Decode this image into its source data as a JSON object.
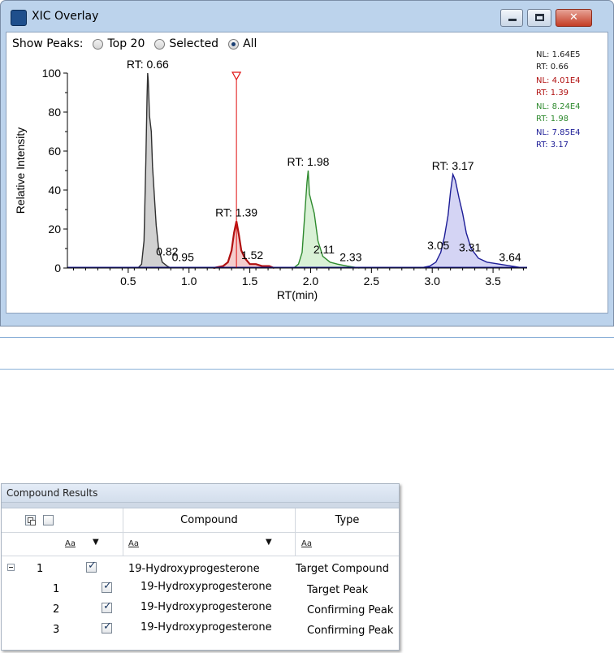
{
  "window": {
    "title": "XIC Overlay"
  },
  "show_peaks": {
    "label": "Show Peaks:",
    "options": [
      "Top 20",
      "Selected",
      "All"
    ],
    "selected": "All"
  },
  "chart_data": {
    "type": "line",
    "xlabel": "RT(min)",
    "ylabel": "Relative Intensity",
    "xlim": [
      0,
      3.78
    ],
    "ylim": [
      0,
      100
    ],
    "xticks": [
      0.5,
      1.0,
      1.5,
      2.0,
      2.5,
      3.0,
      3.5
    ],
    "xtick_labels": [
      "0.5",
      "1.0",
      "1.5",
      "2.0",
      "2.5",
      "3.0",
      "3.5"
    ],
    "yticks": [
      0,
      20,
      40,
      60,
      80,
      100
    ],
    "ytick_labels": [
      "0",
      "20",
      "40",
      "60",
      "80",
      "100"
    ],
    "colors": {
      "grey": "#303030",
      "red": "#b01010",
      "green": "#2e8a2e",
      "blue": "#1c1c96"
    },
    "fills": {
      "grey": "#c9c9c9",
      "red": "#f2c4c4",
      "green": "#d2efcf",
      "blue": "#ccccf2"
    },
    "legend": [
      {
        "nl": "NL: 1.64E5",
        "rt": "RT: 0.66",
        "color": "#202020"
      },
      {
        "nl": "NL: 4.01E4",
        "rt": "RT: 1.39",
        "color": "#b01010"
      },
      {
        "nl": "NL: 8.24E4",
        "rt": "RT: 1.98",
        "color": "#2e8a2e"
      },
      {
        "nl": "NL: 7.85E4",
        "rt": "RT: 3.17",
        "color": "#1c1c96"
      }
    ],
    "series": [
      {
        "color_key": "grey",
        "x": [
          0.58,
          0.61,
          0.63,
          0.645,
          0.655,
          0.66,
          0.665,
          0.675,
          0.69,
          0.7,
          0.715,
          0.73,
          0.75,
          0.78,
          0.82,
          0.85
        ],
        "y": [
          0,
          2,
          14,
          55,
          88,
          100,
          96,
          78,
          70,
          52,
          37,
          22,
          10,
          3,
          1,
          0
        ]
      },
      {
        "color_key": "red",
        "x": [
          1.2,
          1.28,
          1.32,
          1.35,
          1.37,
          1.39,
          1.41,
          1.43,
          1.46,
          1.5,
          1.55,
          1.6,
          1.66,
          1.7
        ],
        "y": [
          0,
          1,
          3,
          9,
          18,
          24,
          17,
          9,
          5,
          2,
          2,
          1,
          1,
          0
        ]
      },
      {
        "color_key": "green",
        "x": [
          1.86,
          1.9,
          1.93,
          1.95,
          1.97,
          1.98,
          1.99,
          2.01,
          2.03,
          2.06,
          2.1,
          2.16,
          2.22,
          2.3,
          2.4
        ],
        "y": [
          0,
          2,
          8,
          26,
          44,
          50,
          38,
          33,
          28,
          14,
          6,
          3,
          2,
          1,
          0
        ]
      },
      {
        "color_key": "blue",
        "x": [
          2.9,
          2.98,
          3.03,
          3.07,
          3.1,
          3.13,
          3.15,
          3.17,
          3.19,
          3.22,
          3.25,
          3.28,
          3.32,
          3.38,
          3.45,
          3.55,
          3.65,
          3.75
        ],
        "y": [
          0,
          1,
          3,
          8,
          16,
          27,
          39,
          48,
          45,
          36,
          28,
          18,
          10,
          5,
          3,
          2,
          1,
          0
        ]
      }
    ],
    "peak_labels": [
      {
        "text": "RT: 0.66",
        "x": 0.66,
        "y": 100
      },
      {
        "text": "0.82",
        "x": 0.82,
        "y": 4
      },
      {
        "text": "0.95",
        "x": 0.95,
        "y": 1
      },
      {
        "text": "RT: 1.39",
        "x": 1.39,
        "y": 24
      },
      {
        "text": "1.52",
        "x": 1.52,
        "y": 2
      },
      {
        "text": "RT: 1.98",
        "x": 1.98,
        "y": 50
      },
      {
        "text": "2.11",
        "x": 2.11,
        "y": 5
      },
      {
        "text": "2.33",
        "x": 2.33,
        "y": 1
      },
      {
        "text": "RT: 3.17",
        "x": 3.17,
        "y": 48
      },
      {
        "text": "3.05",
        "x": 3.05,
        "y": 7
      },
      {
        "text": "3.31",
        "x": 3.31,
        "y": 6
      },
      {
        "text": "3.64",
        "x": 3.64,
        "y": 1
      }
    ],
    "marker": {
      "x": 1.39,
      "color": "#e01010"
    }
  },
  "results": {
    "title": "Compound Results",
    "columns": {
      "compound": "Compound",
      "type": "Type"
    },
    "filter_aa": "Aa",
    "rows": [
      {
        "index": "1",
        "compound": "19-Hydroxyprogesterone",
        "type": "Target Compound",
        "checked": true,
        "level": 0
      },
      {
        "index": "1",
        "compound": "19-Hydroxyprogesterone",
        "type": "Target Peak",
        "checked": true,
        "level": 1
      },
      {
        "index": "2",
        "compound": "19-Hydroxyprogesterone",
        "type": "Confirming Peak",
        "checked": true,
        "level": 1
      },
      {
        "index": "3",
        "compound": "19-Hydroxyprogesterone",
        "type": "Confirming Peak",
        "checked": true,
        "level": 1
      }
    ]
  }
}
